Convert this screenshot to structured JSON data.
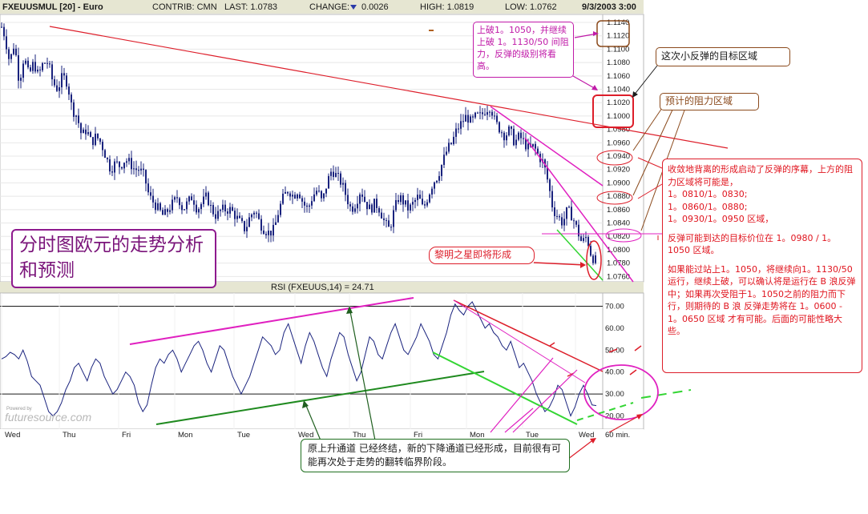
{
  "header": {
    "symbol": "FXEUUSMUL [20] - Euro",
    "contrib": "CONTRIB: CMN",
    "last": "LAST: 1.0783",
    "change_label": "CHANGE:",
    "change_value": "0.0026",
    "change_direction": "down",
    "high": "HIGH: 1.0819",
    "low": "LOW: 1.0762",
    "datetime": "9/3/2003 3:00"
  },
  "title_box": "分时图欧元的走势分析和预测",
  "rsi_label": "RSI (FXEUUS,14) = 24.71",
  "watermark": "futuresource.com",
  "watermark_small": "Powered by",
  "interval_label": "60 min.",
  "days": [
    "Wed",
    "Thu",
    "Fri",
    "Mon",
    "Tue",
    "Wed",
    "Thu",
    "Fri",
    "Mon",
    "Tue",
    "Wed"
  ],
  "annotations": {
    "top_note": "上破1。1050，并继续上破 1。1130/50 间阻力，反弹的级别将看高。",
    "target_zone": "这次小反弹的目标区域",
    "resistance_zone": "预计的阻力区域",
    "morning_star": "黎明之星即将形成",
    "right_note_1": "收敛地背离的形成启动了反弹的序幕，上方的阻力区域将可能是，",
    "right_note_levels": [
      "1。0810/1。0830;",
      "1。0860/1。0880;",
      "1。0930/1。0950 区域，"
    ],
    "right_note_2": "反弹可能到达的目标价位在 1。0980 / 1。1050 区域。",
    "right_note_3": "如果能过站上1。1050，将继续向1。1130/50 运行，继续上破，可以确认将是运行在 B 浪反弹中；如果再次受阻于1。1050之前的阻力而下行，则期待的 B 浪 反弹走势将在 1。0600 - 1。0650 区域 才有可能。后面的可能性略大些。",
    "bottom_note": "原上升通道 已经终结，新的下降通道已经形成，目前很有可能再次处于走势的翻转临界阶段。"
  },
  "colors": {
    "candles": "#1a237e",
    "trend_red": "#dd1e2a",
    "magenta": "#e020c0",
    "green": "#33d533",
    "dark_green": "#1f8a1f",
    "note_red": "#e0141e",
    "note_magenta": "#c01aa8",
    "note_brown": "#8b4a1c"
  },
  "chart_data": [
    {
      "type": "candlestick",
      "interval": "60 min.",
      "y_ticks": [
        1.076,
        1.078,
        1.08,
        1.082,
        1.084,
        1.086,
        1.088,
        1.09,
        1.092,
        1.094,
        1.096,
        1.098,
        1.1,
        1.102,
        1.104,
        1.106,
        1.108,
        1.11,
        1.112,
        1.114
      ],
      "ylim": [
        1.0752,
        1.1152
      ],
      "x_categories": [
        "Wed",
        "Thu",
        "Fri",
        "Mon",
        "Tue",
        "Wed",
        "Thu",
        "Fri",
        "Mon",
        "Tue",
        "Wed"
      ],
      "close_path": [
        [
          0,
          1.114
        ],
        [
          6,
          1.112
        ],
        [
          12,
          1.108
        ],
        [
          18,
          1.111
        ],
        [
          24,
          1.105
        ],
        [
          30,
          1.109
        ],
        [
          36,
          1.106
        ],
        [
          42,
          1.108
        ],
        [
          48,
          1.106
        ],
        [
          54,
          1.108
        ],
        [
          60,
          1.108
        ],
        [
          66,
          1.105
        ],
        [
          72,
          1.104
        ],
        [
          78,
          1.106
        ],
        [
          84,
          1.105
        ],
        [
          90,
          1.101
        ],
        [
          96,
          1.1
        ],
        [
          102,
          1.097
        ],
        [
          108,
          1.098
        ],
        [
          114,
          1.096
        ],
        [
          120,
          1.097
        ],
        [
          126,
          1.096
        ],
        [
          132,
          1.094
        ],
        [
          138,
          1.092
        ],
        [
          144,
          1.093
        ],
        [
          150,
          1.0925
        ],
        [
          156,
          1.0935
        ],
        [
          162,
          1.093
        ],
        [
          168,
          1.092
        ],
        [
          174,
          1.092
        ],
        [
          180,
          1.091
        ],
        [
          186,
          1.088
        ],
        [
          192,
          1.087
        ],
        [
          198,
          1.086
        ],
        [
          204,
          1.085
        ],
        [
          210,
          1.086
        ],
        [
          216,
          1.087
        ],
        [
          222,
          1.088
        ],
        [
          228,
          1.086
        ],
        [
          234,
          1.087
        ],
        [
          240,
          1.088
        ],
        [
          246,
          1.086
        ],
        [
          252,
          1.087
        ],
        [
          258,
          1.088
        ],
        [
          264,
          1.086
        ],
        [
          270,
          1.085
        ],
        [
          276,
          1.086
        ],
        [
          282,
          1.086
        ],
        [
          288,
          1.086
        ],
        [
          294,
          1.085
        ],
        [
          300,
          1.084
        ],
        [
          306,
          1.083
        ],
        [
          312,
          1.085
        ],
        [
          318,
          1.086
        ],
        [
          324,
          1.084
        ],
        [
          330,
          1.083
        ],
        [
          336,
          1.0825
        ],
        [
          342,
          1.083
        ],
        [
          348,
          1.086
        ],
        [
          354,
          1.088
        ],
        [
          360,
          1.089
        ],
        [
          366,
          1.088
        ],
        [
          372,
          1.089
        ],
        [
          378,
          1.087
        ],
        [
          384,
          1.086
        ],
        [
          390,
          1.088
        ],
        [
          396,
          1.089
        ],
        [
          402,
          1.087
        ],
        [
          408,
          1.09
        ],
        [
          414,
          1.092
        ],
        [
          420,
          1.091
        ],
        [
          426,
          1.09
        ],
        [
          432,
          1.088
        ],
        [
          438,
          1.086
        ],
        [
          444,
          1.087
        ],
        [
          450,
          1.089
        ],
        [
          456,
          1.087
        ],
        [
          462,
          1.086
        ],
        [
          468,
          1.087
        ],
        [
          474,
          1.086
        ],
        [
          480,
          1.084
        ],
        [
          486,
          1.083
        ],
        [
          492,
          1.086
        ],
        [
          498,
          1.088
        ],
        [
          504,
          1.087
        ],
        [
          510,
          1.086
        ],
        [
          516,
          1.087
        ],
        [
          522,
          1.088
        ],
        [
          528,
          1.086
        ],
        [
          534,
          1.088
        ],
        [
          540,
          1.09
        ],
        [
          546,
          1.091
        ],
        [
          552,
          1.093
        ],
        [
          558,
          1.095
        ],
        [
          564,
          1.096
        ],
        [
          570,
          1.098
        ],
        [
          576,
          1.099
        ],
        [
          582,
          1.1
        ],
        [
          588,
          1.099
        ],
        [
          594,
          1.1
        ],
        [
          600,
          1.1
        ],
        [
          606,
          1.101
        ],
        [
          612,
          1.1015
        ],
        [
          618,
          1.099
        ],
        [
          624,
          1.098
        ],
        [
          630,
          1.097
        ],
        [
          636,
          1.098
        ],
        [
          642,
          1.096
        ],
        [
          648,
          1.097
        ],
        [
          654,
          1.096
        ],
        [
          660,
          1.095
        ],
        [
          666,
          1.0955
        ],
        [
          672,
          1.094
        ],
        [
          678,
          1.093
        ],
        [
          684,
          1.09
        ],
        [
          690,
          1.086
        ],
        [
          696,
          1.085
        ],
        [
          702,
          1.084
        ],
        [
          708,
          1.086
        ],
        [
          714,
          1.085
        ],
        [
          720,
          1.083
        ],
        [
          726,
          1.081
        ],
        [
          732,
          1.082
        ],
        [
          738,
          1.079
        ],
        [
          744,
          1.0783
        ]
      ]
    },
    {
      "type": "line",
      "name": "RSI (FXEUUS,14)",
      "y_ticks": [
        20.0,
        30.0,
        40.0,
        50.0,
        60.0,
        70.0
      ],
      "ylim": [
        14,
        76
      ],
      "reference_lines": [
        30,
        70
      ],
      "values": [
        46,
        47,
        49,
        48,
        46,
        50,
        45,
        38,
        36,
        34,
        28,
        22,
        20,
        22,
        26,
        32,
        36,
        42,
        44,
        40,
        36,
        42,
        46,
        44,
        38,
        34,
        30,
        32,
        36,
        40,
        38,
        34,
        26,
        22,
        25,
        34,
        42,
        46,
        44,
        48,
        50,
        46,
        40,
        44,
        48,
        52,
        54,
        50,
        44,
        40,
        46,
        52,
        50,
        44,
        38,
        34,
        30,
        34,
        38,
        44,
        50,
        56,
        54,
        52,
        48,
        50,
        58,
        62,
        56,
        50,
        44,
        52,
        58,
        54,
        48,
        42,
        38,
        46,
        52,
        58,
        56,
        48,
        42,
        36,
        40,
        48,
        56,
        54,
        48,
        46,
        52,
        58,
        62,
        56,
        50,
        48,
        52,
        56,
        62,
        58,
        54,
        48,
        46,
        52,
        58,
        66,
        71,
        68,
        66,
        70,
        72,
        68,
        64,
        60,
        62,
        58,
        56,
        52,
        50,
        54,
        48,
        42,
        44,
        40,
        36,
        30,
        26,
        22,
        24,
        28,
        34,
        32,
        26,
        20,
        24,
        30,
        34,
        30,
        25,
        24.71
      ]
    }
  ]
}
